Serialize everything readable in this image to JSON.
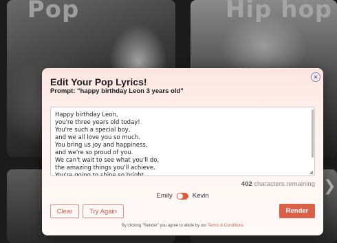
{
  "background": {
    "tiles": [
      {
        "title": "Pop"
      },
      {
        "title": "Hip hop"
      },
      {
        "title": ""
      },
      {
        "title": ""
      }
    ],
    "chevron_icon": "chevron-right-icon"
  },
  "modal": {
    "title": "Edit Your Pop Lyrics!",
    "prompt": "Prompt: \"happy birthday Leon 3 years old\"",
    "close_icon": "close-icon",
    "lyrics": "Happy birthday Leon,\nyou're three years old today!\nYou're such a special boy,\nand we all love you so much.\nYou bring us joy and happiness,\nand we're so proud of you.\nWe can't wait to see what you'll do,\nthe amazing things you'll achieve.\nYou're going to shine so bright,",
    "chars_remaining_count": "402",
    "chars_remaining_label": "characters remaining",
    "voice_left": "Emily",
    "voice_right": "Kevin",
    "toggle_on": true,
    "clear_label": "Clear",
    "try_again_label": "Try Again",
    "render_label": "Render",
    "terms_text": "By clicking \"Render\" you agree to abide by our",
    "terms_link": "Terms & Conditions"
  },
  "colors": {
    "accent": "#d9614a",
    "modal_top": "#fde6e1"
  }
}
